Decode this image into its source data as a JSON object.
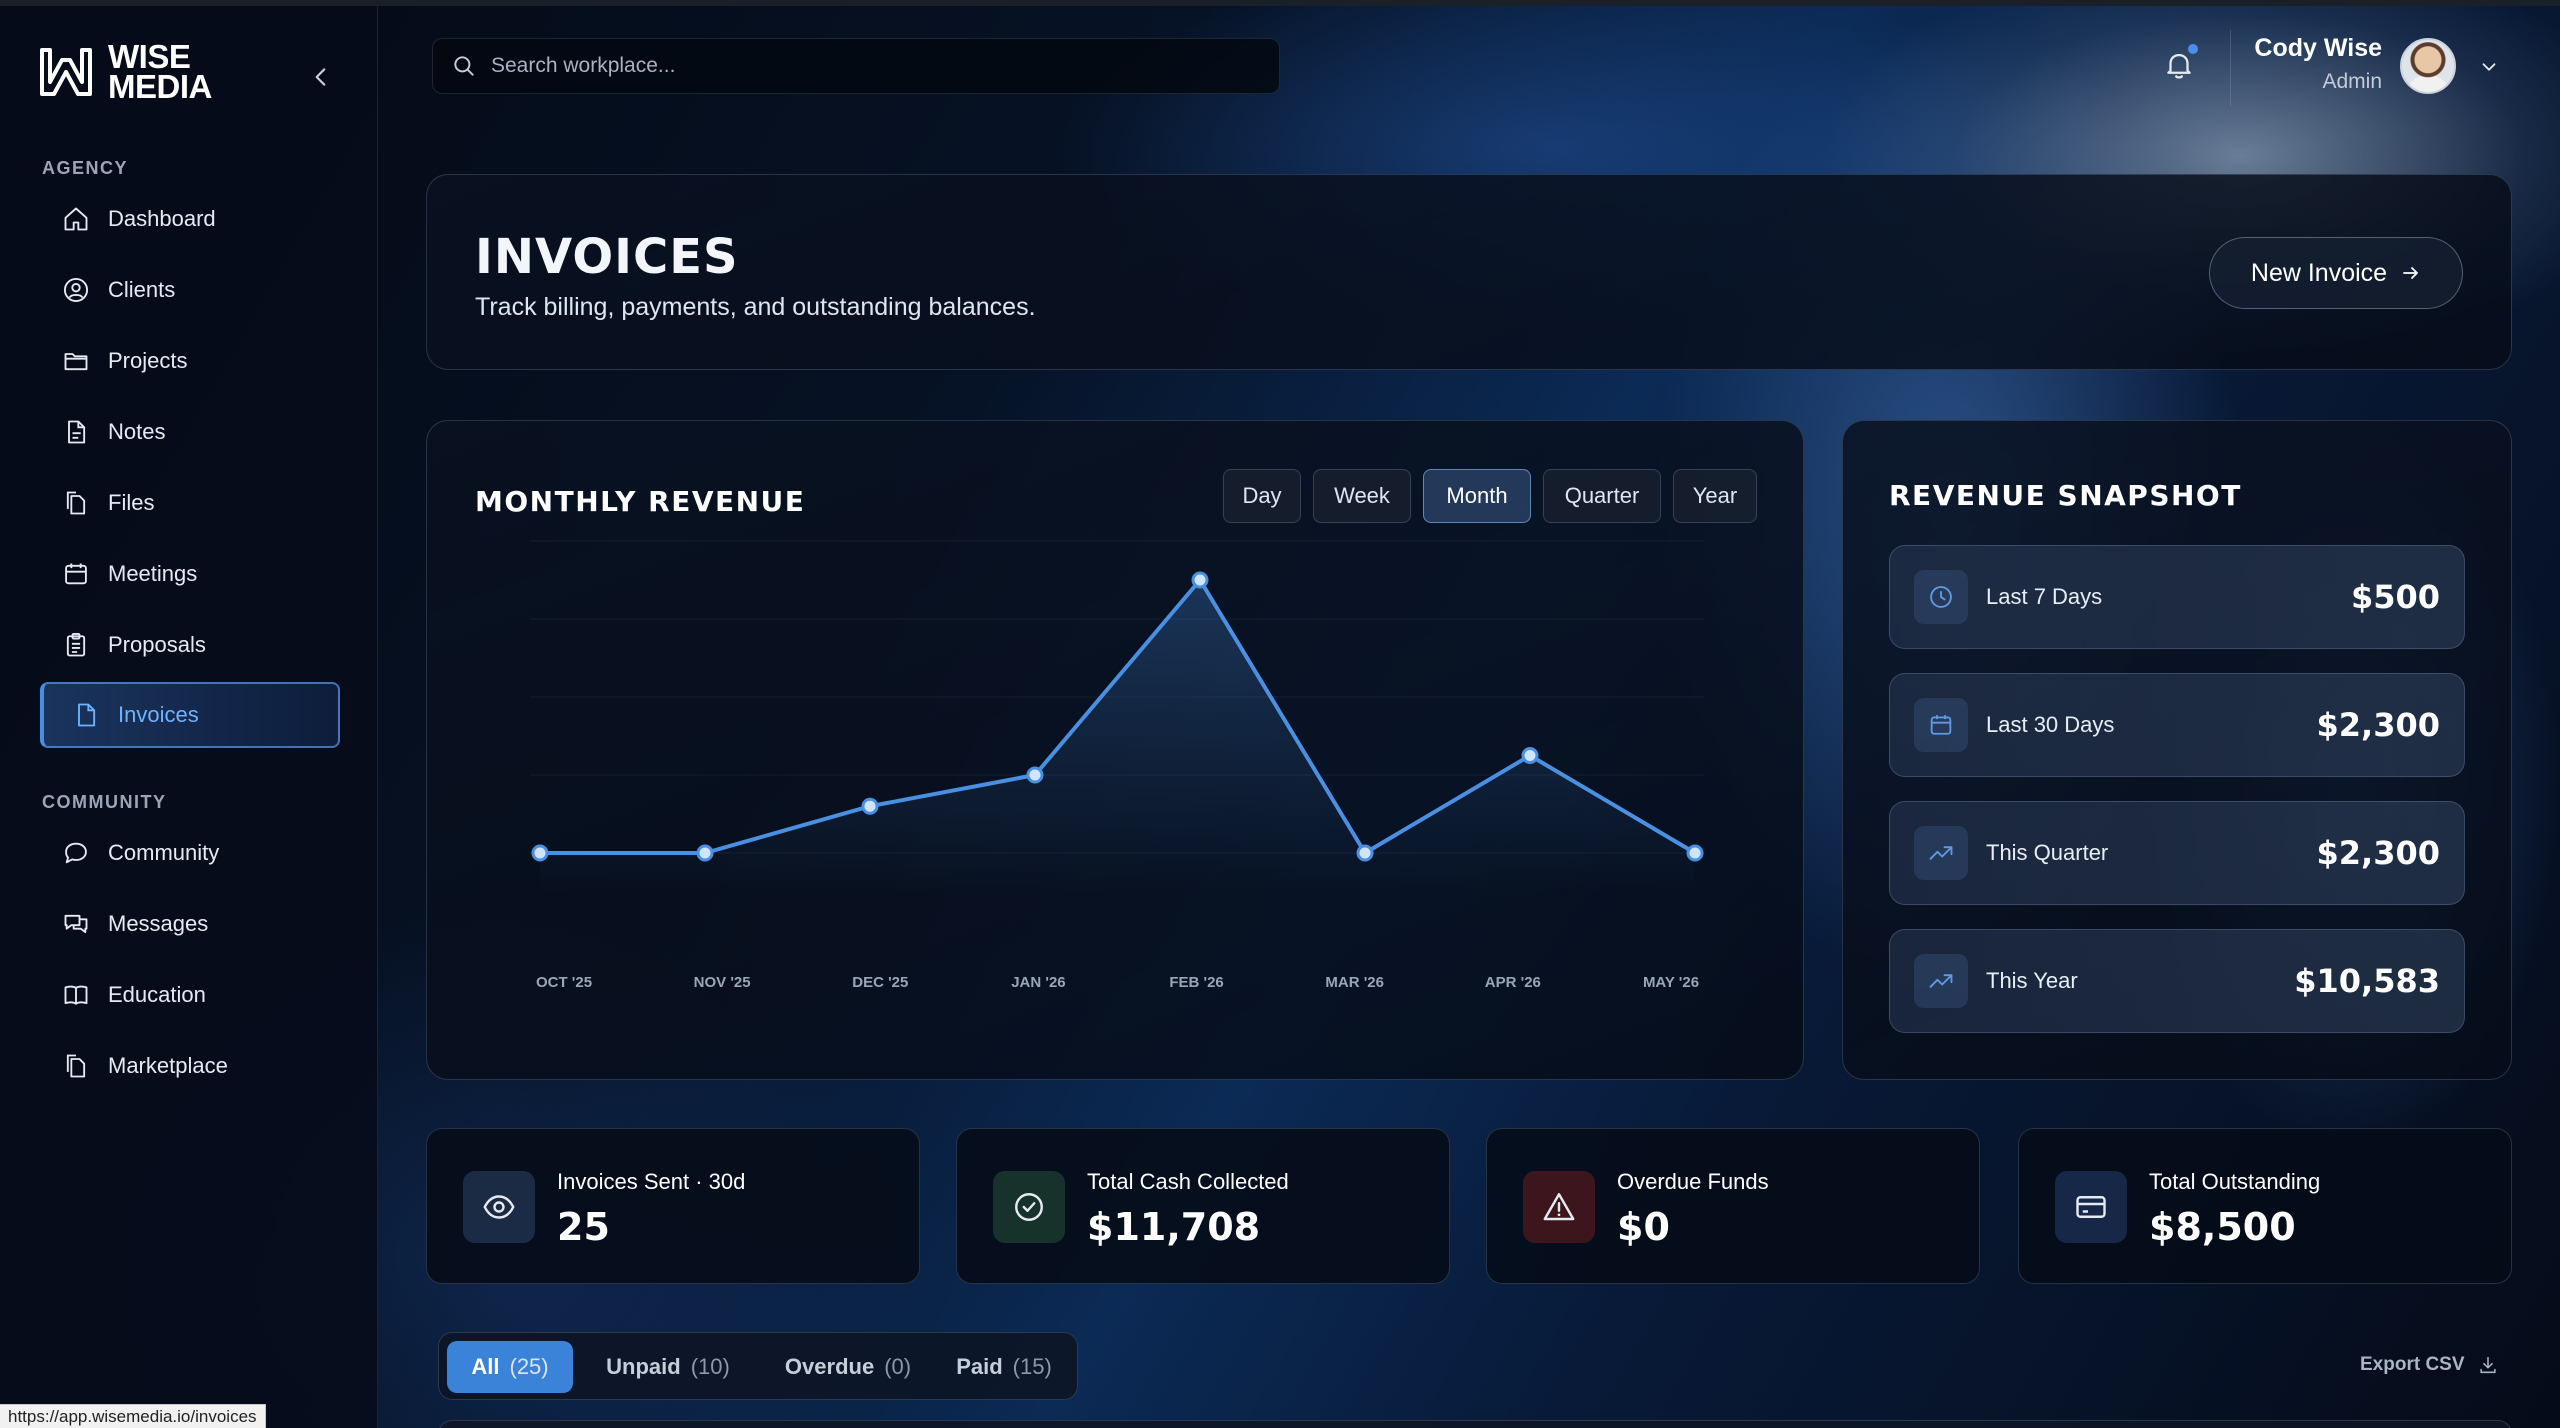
{
  "brand": {
    "line1": "WISE",
    "line2": "MEDIA"
  },
  "sidebar": {
    "sections": [
      {
        "label": "AGENCY",
        "items": [
          {
            "label": "Dashboard",
            "icon": "home-icon"
          },
          {
            "label": "Clients",
            "icon": "user-circle-icon"
          },
          {
            "label": "Projects",
            "icon": "folder-icon"
          },
          {
            "label": "Notes",
            "icon": "note-icon"
          },
          {
            "label": "Files",
            "icon": "files-icon"
          },
          {
            "label": "Meetings",
            "icon": "calendar-icon"
          },
          {
            "label": "Proposals",
            "icon": "clipboard-icon"
          },
          {
            "label": "Invoices",
            "icon": "document-icon",
            "active": true
          }
        ]
      },
      {
        "label": "COMMUNITY",
        "items": [
          {
            "label": "Community",
            "icon": "chat-bubble-icon"
          },
          {
            "label": "Messages",
            "icon": "messages-icon"
          },
          {
            "label": "Education",
            "icon": "book-icon"
          },
          {
            "label": "Marketplace",
            "icon": "marketplace-icon"
          }
        ]
      }
    ]
  },
  "search": {
    "placeholder": "Search workplace..."
  },
  "user": {
    "name": "Cody Wise",
    "role": "Admin"
  },
  "page": {
    "title": "INVOICES",
    "subtitle": "Track billing, payments, and outstanding balances.",
    "new_button": "New Invoice"
  },
  "chart_panel": {
    "title": "MONTHLY REVENUE",
    "ranges": [
      "Day",
      "Week",
      "Month",
      "Quarter",
      "Year"
    ],
    "selected_range": "Month"
  },
  "chart_data": {
    "type": "line",
    "title": "MONTHLY REVENUE",
    "categories": [
      "OCT '25",
      "NOV '25",
      "DEC '25",
      "JAN '26",
      "FEB '26",
      "MAR '26",
      "APR '26",
      "MAY '26"
    ],
    "series": [
      {
        "values": [
          0,
          0,
          600,
          1000,
          3500,
          0,
          1250,
          0
        ]
      }
    ],
    "ylim": [
      0,
      4000
    ],
    "grid": true,
    "line_color": "#4a90e2"
  },
  "snapshot": {
    "title": "REVENUE SNAPSHOT",
    "rows": [
      {
        "label": "Last 7 Days",
        "value": "$500",
        "icon": "clock-icon"
      },
      {
        "label": "Last 30 Days",
        "value": "$2,300",
        "icon": "calendar-icon"
      },
      {
        "label": "This Quarter",
        "value": "$2,300",
        "icon": "trending-up-icon"
      },
      {
        "label": "This Year",
        "value": "$10,583",
        "icon": "trending-up-icon"
      }
    ]
  },
  "stats": [
    {
      "label": "Invoices Sent · 30d",
      "value": "25",
      "icon": "eye-icon",
      "color": "#6fa8ff"
    },
    {
      "label": "Total Cash Collected",
      "value": "$11,708",
      "icon": "check-circle-icon",
      "color": "#8fe3a8"
    },
    {
      "label": "Overdue Funds",
      "value": "$0",
      "icon": "warning-icon",
      "color": "#ff8c8c"
    },
    {
      "label": "Total Outstanding",
      "value": "$8,500",
      "icon": "credit-card-icon",
      "color": "#9cc4ff"
    }
  ],
  "filters": [
    {
      "label": "All",
      "count": "(25)",
      "active": true
    },
    {
      "label": "Unpaid",
      "count": "(10)"
    },
    {
      "label": "Overdue",
      "count": "(0)"
    },
    {
      "label": "Paid",
      "count": "(15)"
    }
  ],
  "export_label": "Export CSV",
  "status_url": "https://app.wisemedia.io/invoices",
  "colors": {
    "accent": "#4a90e2",
    "active_tab": "#3b82d9",
    "background": "#050a14"
  }
}
